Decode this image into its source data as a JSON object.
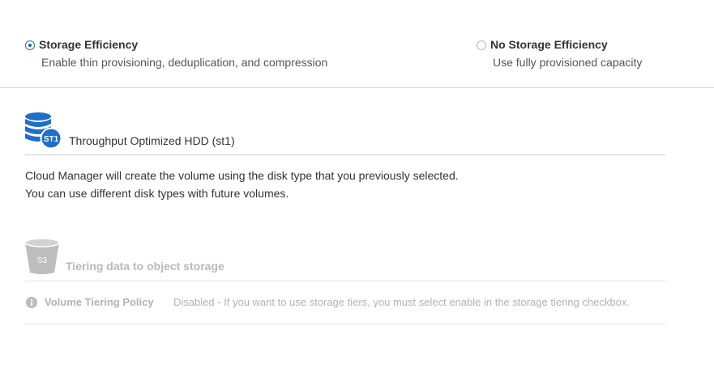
{
  "efficiency": {
    "storage_efficiency": {
      "title": "Storage Efficiency",
      "subtitle": "Enable thin provisioning, deduplication, and compression",
      "selected": true
    },
    "no_storage_efficiency": {
      "title": "No Storage Efficiency",
      "subtitle": "Use fully provisioned capacity",
      "selected": false
    }
  },
  "disk": {
    "icon": "database-st1-icon",
    "badge": "ST1",
    "title": "Throughput Optimized HDD (st1)",
    "description_line1": "Cloud Manager will create the volume using the disk type that you previously selected.",
    "description_line2": "You can use different disk types with future volumes."
  },
  "tiering": {
    "icon": "s3-bucket-icon",
    "badge": "S3",
    "title": "Tiering data to object storage",
    "policy_label": "Volume Tiering Policy",
    "policy_value": "Disabled - If you want to use storage tiers, you must select enable in the storage tiering checkbox."
  },
  "colors": {
    "accent": "#1f6fc6",
    "disabled_text": "#b3b3b3"
  }
}
